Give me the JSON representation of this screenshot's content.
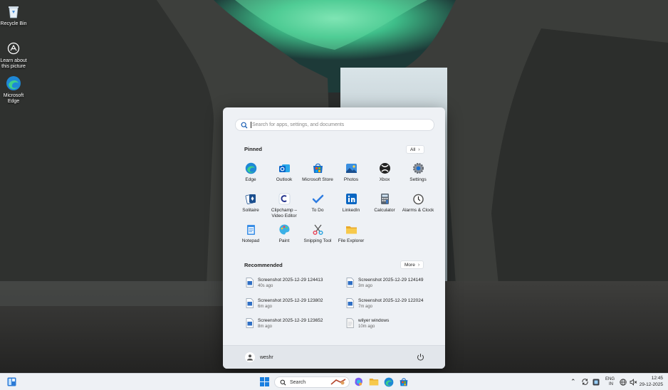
{
  "desktop": {
    "icons": [
      {
        "label": "Recycle Bin",
        "icon": "recycle-bin-icon"
      },
      {
        "label": "Learn about this picture",
        "icon": "learn-picture-icon"
      },
      {
        "label": "Microsoft Edge",
        "icon": "edge-icon"
      }
    ]
  },
  "start": {
    "search_placeholder": "Search for apps, settings, and documents",
    "pinned_title": "Pinned",
    "all_label": "All",
    "pinned": [
      {
        "label": "Edge",
        "icon": "edge-icon"
      },
      {
        "label": "Outlook",
        "icon": "outlook-icon"
      },
      {
        "label": "Microsoft Store",
        "icon": "store-icon"
      },
      {
        "label": "Photos",
        "icon": "photos-icon"
      },
      {
        "label": "Xbox",
        "icon": "xbox-icon"
      },
      {
        "label": "Settings",
        "icon": "settings-icon"
      },
      {
        "label": "Solitaire",
        "icon": "solitaire-icon"
      },
      {
        "label": "Clipchamp – Video Editor",
        "icon": "clipchamp-icon"
      },
      {
        "label": "To Do",
        "icon": "todo-icon"
      },
      {
        "label": "LinkedIn",
        "icon": "linkedin-icon"
      },
      {
        "label": "Calculator",
        "icon": "calculator-icon"
      },
      {
        "label": "Alarms & Clock",
        "icon": "clock-icon"
      },
      {
        "label": "Notepad",
        "icon": "notepad-icon"
      },
      {
        "label": "Paint",
        "icon": "paint-icon"
      },
      {
        "label": "Snipping Tool",
        "icon": "snipping-icon"
      },
      {
        "label": "File Explorer",
        "icon": "folder-icon"
      }
    ],
    "recommended_title": "Recommended",
    "more_label": "More",
    "recommended": [
      {
        "name": "Screenshot 2025-12-29 124413",
        "time": "40s ago",
        "icon": "image-file-icon"
      },
      {
        "name": "Screenshot 2025-12-29 124149",
        "time": "3m ago",
        "icon": "image-file-icon"
      },
      {
        "name": "Screenshot 2025-12-29 123802",
        "time": "6m ago",
        "icon": "image-file-icon"
      },
      {
        "name": "Screenshot 2025-12-29 122024",
        "time": "7m ago",
        "icon": "image-file-icon"
      },
      {
        "name": "Screenshot 2025-12-29 123652",
        "time": "8m ago",
        "icon": "image-file-icon"
      },
      {
        "name": "wilyer windows",
        "time": "10m ago",
        "icon": "text-file-icon"
      }
    ],
    "user_name": "weshr"
  },
  "taskbar": {
    "search_label": "Search",
    "lang_top": "ENG",
    "lang_bottom": "IN",
    "time": "12:45",
    "date": "29-12-2025"
  }
}
